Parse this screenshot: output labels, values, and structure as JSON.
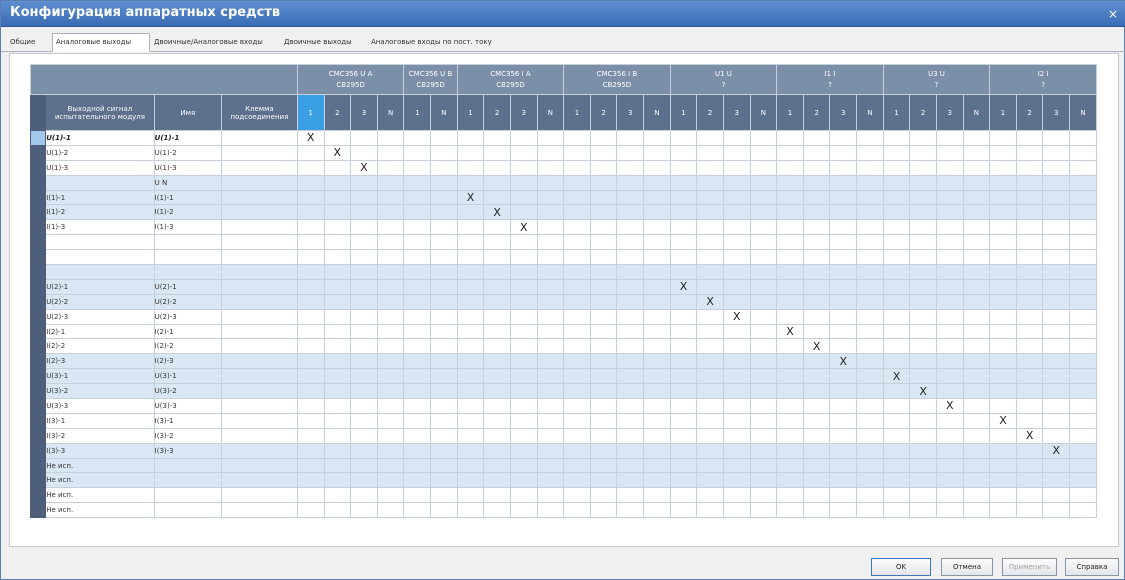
{
  "window": {
    "title": "Конфигурация аппаратных средств",
    "close": "×"
  },
  "tabs": [
    {
      "label": "Общие",
      "active": false
    },
    {
      "label": "Аналоговые выходы",
      "active": true
    },
    {
      "label": "Двоичные/Аналоговые входы",
      "active": false
    },
    {
      "label": "Двоичные выходы",
      "active": false
    },
    {
      "label": "Аналоговые входы по пост. току",
      "active": false
    }
  ],
  "table": {
    "col_headers": {
      "signal": "Выходной сигнал испытательного модуля",
      "name": "Имя",
      "terminal": "Клемма подсоединения"
    },
    "groups": [
      {
        "line1": "CMC356 U A",
        "line2": "CB295D",
        "channels": [
          "1",
          "2",
          "3",
          "N"
        ]
      },
      {
        "line1": "CMC356 U B",
        "line2": "CB295D",
        "channels": [
          "1",
          "N"
        ]
      },
      {
        "line1": "CMC356 I A",
        "line2": "CB295D",
        "channels": [
          "1",
          "2",
          "3",
          "N"
        ]
      },
      {
        "line1": "CMC356 I B",
        "line2": "CB295D",
        "channels": [
          "1",
          "2",
          "3",
          "N"
        ]
      },
      {
        "line1": "U1 U",
        "line2": "?",
        "channels": [
          "1",
          "2",
          "3",
          "N"
        ]
      },
      {
        "line1": "I1 I",
        "line2": "?",
        "channels": [
          "1",
          "2",
          "3",
          "N"
        ]
      },
      {
        "line1": "U3 U",
        "line2": "?",
        "channels": [
          "1",
          "2",
          "3",
          "N"
        ]
      },
      {
        "line1": "I2 I",
        "line2": "?",
        "channels": [
          "1",
          "2",
          "3",
          "N"
        ]
      }
    ],
    "mark": "X",
    "rows": [
      {
        "signal": "U(1)-1",
        "name": "U(1)-1",
        "x": 0,
        "alt": false,
        "bold": true
      },
      {
        "signal": "U(1)-2",
        "name": "U(1)-2",
        "x": 1,
        "alt": false
      },
      {
        "signal": "U(1)-3",
        "name": "U(1)-3",
        "x": 2,
        "alt": false
      },
      {
        "signal": "",
        "name": "U N",
        "x": null,
        "alt": true
      },
      {
        "signal": "I(1)-1",
        "name": "I(1)-1",
        "x": 6,
        "alt": true
      },
      {
        "signal": "I(1)-2",
        "name": "I(1)-2",
        "x": 7,
        "alt": true
      },
      {
        "signal": "I(1)-3",
        "name": "I(1)-3",
        "x": 8,
        "alt": false
      },
      {
        "signal": "",
        "name": "",
        "x": null,
        "alt": false
      },
      {
        "signal": "",
        "name": "",
        "x": null,
        "alt": false
      },
      {
        "signal": "",
        "name": "",
        "x": null,
        "alt": true
      },
      {
        "signal": "U(2)-1",
        "name": "U(2)-1",
        "x": 14,
        "alt": true
      },
      {
        "signal": "U(2)-2",
        "name": "U(2)-2",
        "x": 15,
        "alt": true
      },
      {
        "signal": "U(2)-3",
        "name": "U(2)-3",
        "x": 16,
        "alt": false
      },
      {
        "signal": "I(2)-1",
        "name": "I(2)-1",
        "x": 18,
        "alt": false
      },
      {
        "signal": "I(2)-2",
        "name": "I(2)-2",
        "x": 19,
        "alt": false
      },
      {
        "signal": "I(2)-3",
        "name": "I(2)-3",
        "x": 20,
        "alt": true
      },
      {
        "signal": "U(3)-1",
        "name": "U(3)-1",
        "x": 22,
        "alt": true
      },
      {
        "signal": "U(3)-2",
        "name": "U(3)-2",
        "x": 23,
        "alt": true
      },
      {
        "signal": "U(3)-3",
        "name": "U(3)-3",
        "x": 24,
        "alt": false
      },
      {
        "signal": "I(3)-1",
        "name": "I(3)-1",
        "x": 26,
        "alt": false
      },
      {
        "signal": "I(3)-2",
        "name": "I(3)-2",
        "x": 27,
        "alt": false
      },
      {
        "signal": "I(3)-3",
        "name": "I(3)-3",
        "x": 28,
        "alt": true
      },
      {
        "signal": "Не исп.",
        "name": "",
        "x": null,
        "alt": true
      },
      {
        "signal": "Не исп.",
        "name": "",
        "x": null,
        "alt": true
      },
      {
        "signal": "Не исп.",
        "name": "",
        "x": null,
        "alt": false
      },
      {
        "signal": "Не исп.",
        "name": "",
        "x": null,
        "alt": false
      }
    ]
  },
  "buttons": {
    "ok": "OK",
    "cancel": "Отмена",
    "apply": "Применить",
    "help": "Справка"
  },
  "colors": {
    "title_bar": "#3a6cb5",
    "header": "#5d718d",
    "selected_channel": "#3a9fe3",
    "alt_row": "#d9e7f5"
  }
}
